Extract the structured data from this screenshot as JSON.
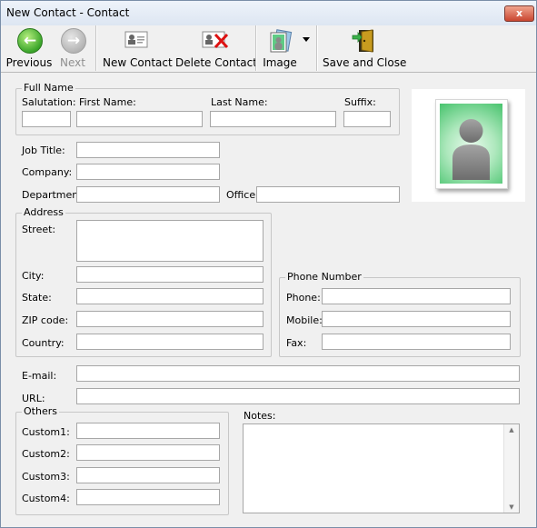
{
  "window": {
    "title": "New Contact - Contact",
    "close": "x"
  },
  "toolbar": {
    "previous": "Previous",
    "next": "Next",
    "new_contact": "New Contact",
    "delete_contact": "Delete Contact",
    "image": "Image",
    "save_close": "Save and Close"
  },
  "full_name": {
    "legend": "Full Name",
    "salutation_label": "Salutation:",
    "first_name_label": "First Name:",
    "last_name_label": "Last Name:",
    "suffix_label": "Suffix:",
    "salutation": "",
    "first_name": "",
    "last_name": "",
    "suffix": ""
  },
  "work": {
    "job_title_label": "Job Title:",
    "company_label": "Company:",
    "department_label": "Department:",
    "office_label": "Office:",
    "job_title": "",
    "company": "",
    "department": "",
    "office": ""
  },
  "address": {
    "legend": "Address",
    "street_label": "Street:",
    "city_label": "City:",
    "state_label": "State:",
    "zip_label": "ZIP code:",
    "country_label": "Country:",
    "street": "",
    "city": "",
    "state": "",
    "zip": "",
    "country": ""
  },
  "phone": {
    "legend": "Phone Number",
    "phone_label": "Phone:",
    "mobile_label": "Mobile:",
    "fax_label": "Fax:",
    "phone": "",
    "mobile": "",
    "fax": ""
  },
  "online": {
    "email_label": "E-mail:",
    "url_label": "URL:",
    "email": "",
    "url": ""
  },
  "others": {
    "legend": "Others",
    "custom1_label": "Custom1:",
    "custom2_label": "Custom2:",
    "custom3_label": "Custom3:",
    "custom4_label": "Custom4:",
    "custom1": "",
    "custom2": "",
    "custom3": "",
    "custom4": ""
  },
  "notes": {
    "label": "Notes:",
    "value": ""
  },
  "icons": {
    "previous": "green-left-arrow-icon",
    "next": "grey-right-arrow-icon",
    "new_contact": "contact-card-icon",
    "delete_contact": "contact-card-delete-icon",
    "image": "image-icon",
    "save_close": "save-close-door-icon"
  }
}
